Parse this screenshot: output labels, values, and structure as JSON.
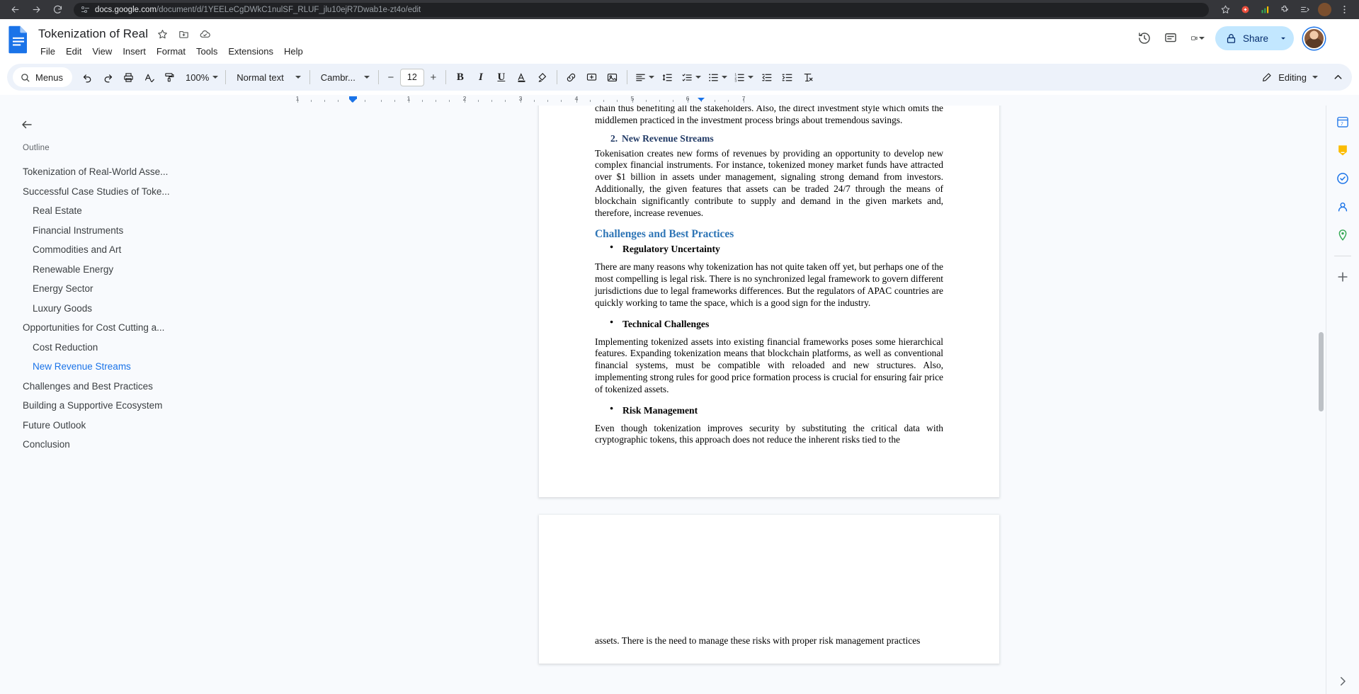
{
  "browser": {
    "url_prefix": "docs.google.com",
    "url_suffix": "/document/d/1YEELeCgDWkC1nulSF_RLUF_jlu10ejR7Dwab1e-zt4o/edit",
    "back_icon": "back-arrow-icon",
    "forward_icon": "forward-arrow-icon",
    "reload_icon": "reload-icon",
    "site_settings_icon": "page-settings-icon",
    "bookmark_icon": "star-icon",
    "extensions_icon": "puzzle-icon",
    "profile_initial": ""
  },
  "docs": {
    "title": "Tokenization of Real",
    "logo_name": "google-docs-logo",
    "title_icons": [
      "star-icon",
      "move-to-folder-icon",
      "cloud-saved-icon"
    ],
    "menus": [
      "File",
      "Edit",
      "View",
      "Insert",
      "Format",
      "Tools",
      "Extensions",
      "Help"
    ],
    "header_right": {
      "history_label": "version-history",
      "comments_label": "comments",
      "meet_label": "meet",
      "share_label": "Share"
    }
  },
  "toolbar": {
    "menus_label": "Menus",
    "zoom_level": "100%",
    "paragraph_style": "Normal text",
    "font_name": "Cambr...",
    "font_size": "12",
    "decrease_label": "−",
    "increase_label": "+",
    "bold_label": "B",
    "italic_label": "I",
    "underline_label": "U",
    "editing_mode": "Editing"
  },
  "ruler": {
    "marks": [
      "1",
      "1",
      "2",
      "3",
      "4",
      "5",
      "6",
      "7"
    ]
  },
  "outline": {
    "panel_label": "Outline",
    "items": [
      {
        "label": "Tokenization of Real-World Asse...",
        "level": 1,
        "active": false
      },
      {
        "label": "Successful Case Studies of Toke...",
        "level": 1,
        "active": false
      },
      {
        "label": "Real Estate",
        "level": 2,
        "active": false
      },
      {
        "label": "Financial Instruments",
        "level": 2,
        "active": false
      },
      {
        "label": "Commodities and Art",
        "level": 2,
        "active": false
      },
      {
        "label": "Renewable Energy",
        "level": 2,
        "active": false
      },
      {
        "label": "Energy Sector",
        "level": 2,
        "active": false
      },
      {
        "label": "Luxury Goods",
        "level": 2,
        "active": false
      },
      {
        "label": "Opportunities for Cost Cutting a...",
        "level": 1,
        "active": false
      },
      {
        "label": "Cost Reduction",
        "level": 2,
        "active": false
      },
      {
        "label": "New Revenue Streams",
        "level": 2,
        "active": true
      },
      {
        "label": "Challenges and Best Practices",
        "level": 1,
        "active": false
      },
      {
        "label": "Building a Supportive Ecosystem",
        "level": 1,
        "active": false
      },
      {
        "label": "Future Outlook",
        "level": 1,
        "active": false
      },
      {
        "label": "Conclusion",
        "level": 1,
        "active": false
      }
    ]
  },
  "document": {
    "page1": {
      "top_paragraph": "chain thus benefiting all the stakeholders. Also, the direct investment style which omits the middlemen practiced in the investment process brings about tremendous savings.",
      "heading_number": "2.",
      "heading_text": "New Revenue Streams",
      "para_revenue": "Tokenisation creates new forms of revenues by providing an opportunity to develop new complex financial instruments. For instance, tokenized money market funds have attracted over $1 billion in assets under management, signaling strong demand from investors. Additionally, the given features that assets can be traded 24/7 through the means of blockchain significantly contribute to supply and demand in the given markets and, therefore, increase revenues.",
      "section_heading": "Challenges and Best Practices",
      "bullet1": "Regulatory Uncertainty",
      "para_bullet1": "There are many reasons why tokenization has not quite taken off yet, but perhaps one of the most compelling is legal risk. There is no synchronized legal framework to govern different jurisdictions due to legal frameworks differences. But the regulators of APAC countries are quickly working to tame the space, which is a good sign for the industry.",
      "bullet2": "Technical Challenges",
      "para_bullet2": "Implementing tokenized assets into existing financial frameworks poses some hierarchical features. Expanding tokenization means that blockchain platforms, as well as conventional financial systems, must be compatible with reloaded and new structures. Also, implementing strong rules for good price formation process is crucial for ensuring fair price of tokenized assets.",
      "bullet3": "Risk Management",
      "para_bullet3": "Even though tokenization improves security by substituting the critical data with cryptographic tokens, this approach does not reduce the inherent risks tied to the"
    },
    "page2": {
      "para_continued": "assets. There is the need to manage these risks with proper risk management practices"
    }
  },
  "app_rail": {
    "icons": [
      "calendar-icon",
      "keep-icon",
      "tasks-icon",
      "contacts-icon",
      "maps-icon",
      "add-apps-icon",
      "expand-panel-icon"
    ]
  }
}
